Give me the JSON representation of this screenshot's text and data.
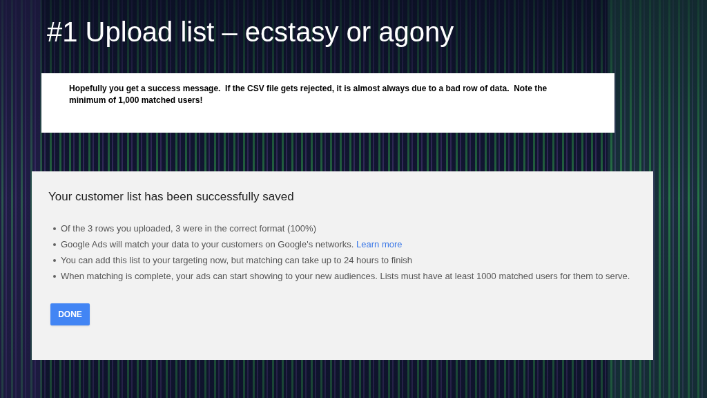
{
  "slide": {
    "title": "#1 Upload list – ecstasy or agony",
    "note": "Hopefully you get a success message.  If the CSV file gets rejected, it is almost always due to a bad row of data.  Note the minimum of 1,000 matched users!"
  },
  "dialog": {
    "heading": "Your customer list has been successfully saved",
    "bullets": [
      {
        "text": "Of the 3 rows you uploaded, 3 were in the correct format (100%)"
      },
      {
        "text": "Google Ads will match your data to your customers on Google's networks.",
        "link": "Learn more"
      },
      {
        "text": "You can add this list to your targeting now, but matching can take up to 24 hours to finish"
      },
      {
        "text": "When matching is complete, your ads can start showing to your new audiences. Lists must have at least 1000 matched users for them to serve."
      }
    ],
    "button": "DONE"
  }
}
